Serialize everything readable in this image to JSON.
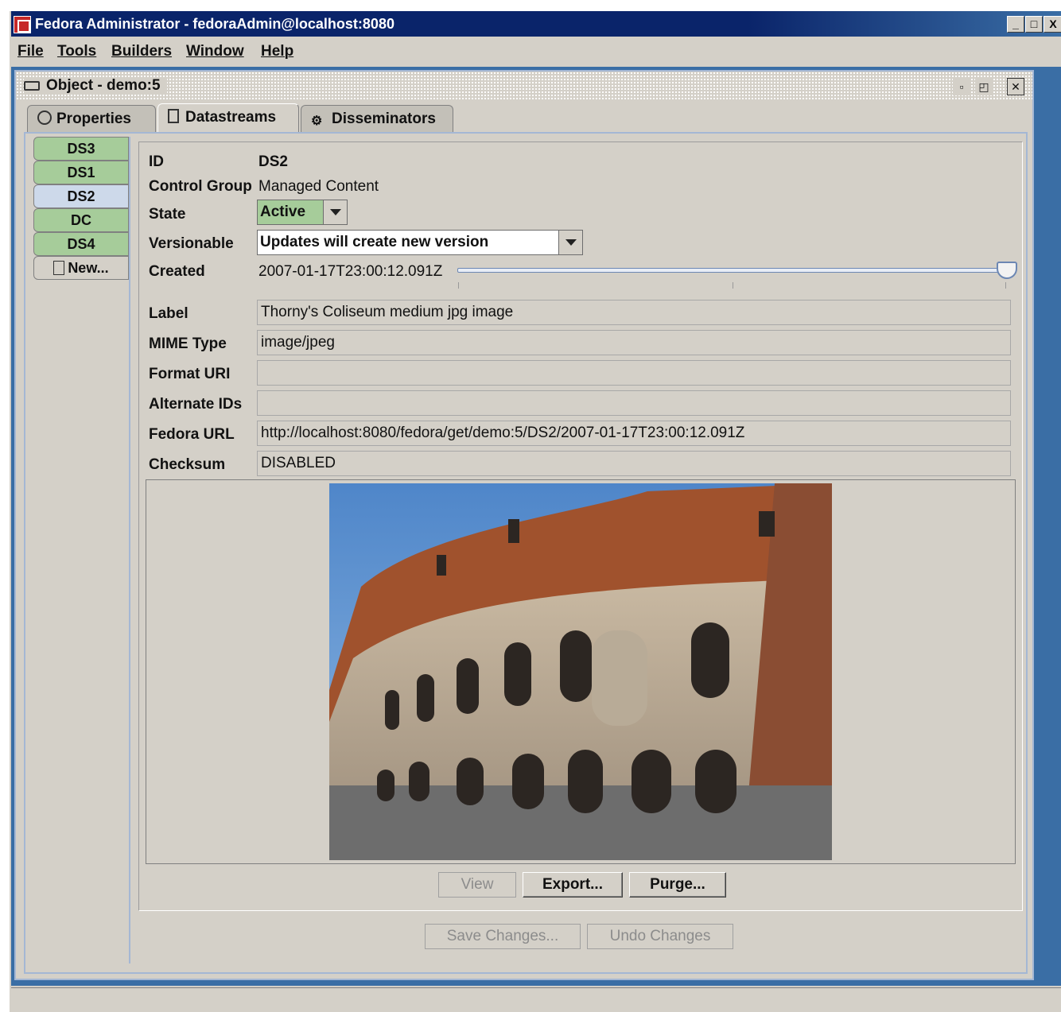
{
  "window": {
    "title": "Fedora Administrator - fedoraAdmin@localhost:8080",
    "controls": {
      "minimize": "_",
      "maximize": "□",
      "close": "X"
    }
  },
  "menu": {
    "items": [
      {
        "label": "File"
      },
      {
        "label": "Tools"
      },
      {
        "label": "Builders"
      },
      {
        "label": "Window"
      },
      {
        "label": "Help"
      }
    ]
  },
  "object_frame": {
    "title": "Object - demo:5",
    "tabs": [
      {
        "label": "Properties",
        "icon": "properties-icon"
      },
      {
        "label": "Datastreams",
        "icon": "datastreams-icon",
        "active": true
      },
      {
        "label": "Disseminators",
        "icon": "disseminators-icon"
      }
    ]
  },
  "datastream_list": [
    {
      "label": "DS3"
    },
    {
      "label": "DS1"
    },
    {
      "label": "DS2",
      "active": true
    },
    {
      "label": "DC"
    },
    {
      "label": "DS4"
    },
    {
      "label": "New..."
    }
  ],
  "datastream": {
    "id_label": "ID",
    "id": "DS2",
    "control_group_label": "Control Group",
    "control_group": "Managed Content",
    "state_label": "State",
    "state": "Active",
    "versionable_label": "Versionable",
    "versionable": "Updates will create new version",
    "created_label": "Created",
    "created": "2007-01-17T23:00:12.091Z",
    "version_position": 1.0,
    "label_label": "Label",
    "label": "Thorny's Coliseum medium jpg image",
    "mime_label": "MIME Type",
    "mime": "image/jpeg",
    "format_uri_label": "Format URI",
    "format_uri": "",
    "alt_ids_label": "Alternate IDs",
    "alt_ids": "",
    "fedora_url_label": "Fedora URL",
    "fedora_url": "http://localhost:8080/fedora/get/demo:5/DS2/2007-01-17T23:00:12.091Z",
    "checksum_label": "Checksum",
    "checksum": "DISABLED"
  },
  "actions": {
    "view": "View",
    "export": "Export...",
    "purge": "Purge...",
    "save": "Save Changes...",
    "undo": "Undo Changes"
  },
  "colors": {
    "title_bar": "#0a246a",
    "desktop": "#3a6ea5",
    "ds_tab": "#a6cc9a",
    "ds_tab_active": "#cdd9ea",
    "state_active": "#a6cc9a"
  }
}
